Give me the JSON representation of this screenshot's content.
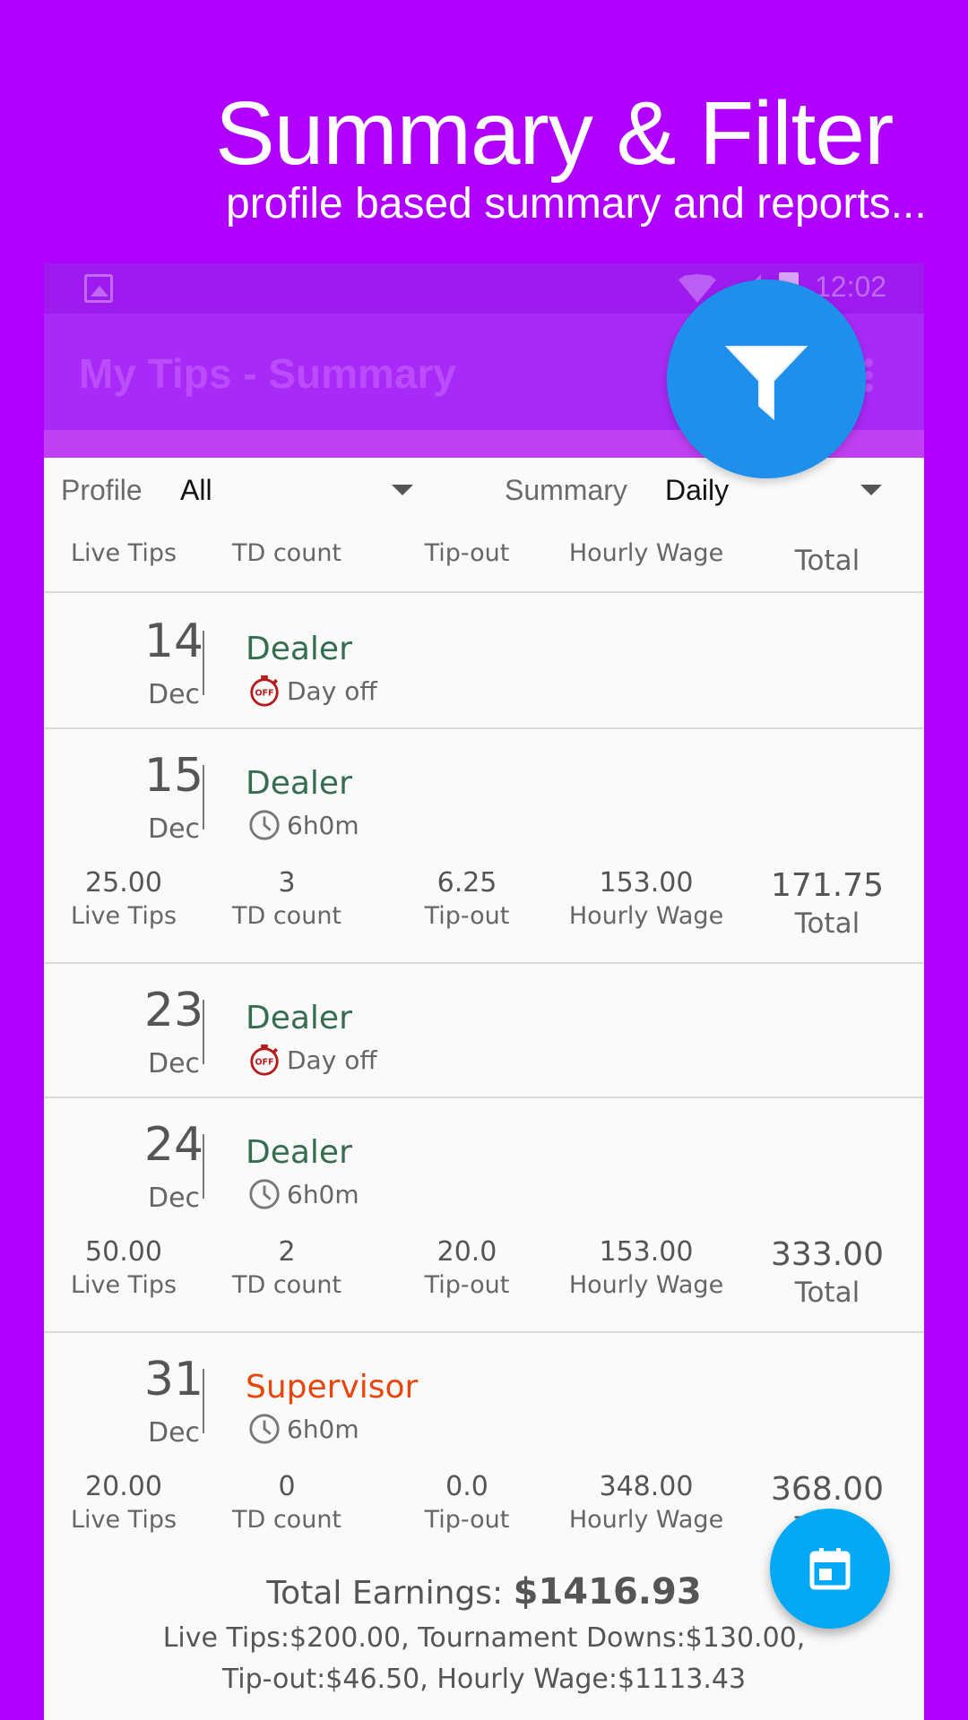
{
  "promo": {
    "title": "Summary & Filter",
    "subtitle": "profile based summary and reports..."
  },
  "status_bar": {
    "time": "12:02"
  },
  "app_bar": {
    "title": "My Tips - Summary"
  },
  "filters": {
    "profile_label": "Profile",
    "profile_value": "All",
    "summary_label": "Summary",
    "summary_value": "Daily"
  },
  "columns": [
    "Live Tips",
    "TD count",
    "Tip-out",
    "Hourly Wage",
    "Total"
  ],
  "entries": [
    {
      "day": "14",
      "month": "Dec",
      "role": "Dealer",
      "status": "Day off",
      "status_icon": "day-off-icon"
    },
    {
      "day": "15",
      "month": "Dec",
      "role": "Dealer",
      "status": "6h0m",
      "status_icon": "clock-icon",
      "live_tips": "25.00",
      "td_count": "3",
      "tip_out": "6.25",
      "hourly_wage": "153.00",
      "total": "171.75"
    },
    {
      "day": "23",
      "month": "Dec",
      "role": "Dealer",
      "status": "Day off",
      "status_icon": "day-off-icon"
    },
    {
      "day": "24",
      "month": "Dec",
      "role": "Dealer",
      "status": "6h0m",
      "status_icon": "clock-icon",
      "live_tips": "50.00",
      "td_count": "2",
      "tip_out": "20.0",
      "hourly_wage": "153.00",
      "total": "333.00"
    },
    {
      "day": "31",
      "month": "Dec",
      "role": "Supervisor",
      "status": "6h0m",
      "status_icon": "clock-icon",
      "live_tips": "20.00",
      "td_count": "0",
      "tip_out": "0.0",
      "hourly_wage": "348.00",
      "total": "368.00"
    }
  ],
  "totals": {
    "label": "Total Earnings:",
    "value": "$1416.93",
    "line1": "Live Tips:$200.00, Tournament Downs:$130.00,",
    "line2": "Tip-out:$46.50, Hourly Wage:$1113.43"
  },
  "colors": {
    "background": "#B000FF",
    "filter_fab": "#1E8FEA",
    "calendar_fab": "#03A9F4",
    "dealer_text": "#356D4F",
    "supervisor_text": "#E8460C"
  }
}
